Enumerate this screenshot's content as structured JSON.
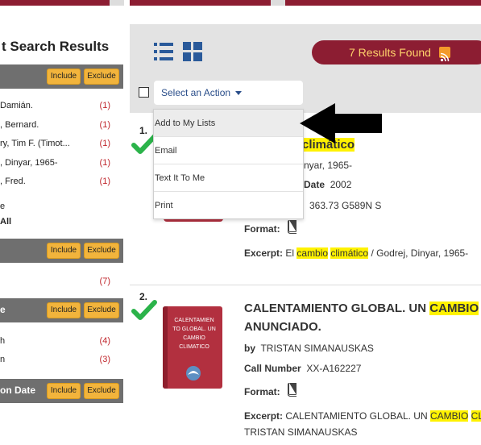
{
  "sidebar": {
    "title": "t Search Results",
    "facets": [
      {
        "label": "",
        "include": "Include",
        "exclude": "Exclude",
        "items": [
          {
            "name": "Damián.",
            "count": "(1)"
          },
          {
            "name": ", Bernard.",
            "count": "(1)"
          },
          {
            "name": "ry, Tim F. (Timot...",
            "count": "(1)"
          },
          {
            "name": ", Dinyar, 1965-",
            "count": "(1)"
          },
          {
            "name": ", Fred.",
            "count": "(1)"
          }
        ],
        "more": "e",
        "all": "All"
      },
      {
        "label": "",
        "include": "Include",
        "exclude": "Exclude",
        "items": [
          {
            "name": "",
            "count": "(7)"
          }
        ]
      },
      {
        "label": "e",
        "include": "Include",
        "exclude": "Exclude",
        "items": [
          {
            "name": "h",
            "count": "(4)"
          },
          {
            "name": "n",
            "count": "(3)"
          }
        ]
      },
      {
        "label": "on Date",
        "include": "Include",
        "exclude": "Exclude",
        "items": []
      }
    ]
  },
  "toolbar": {
    "list_view_icon": "list-icon",
    "grid_view_icon": "grid-icon",
    "results_found": "7 Results Found",
    "rss_icon": "rss-icon",
    "action_select": {
      "value": "Select an Action",
      "options": [
        "Add to My Lists",
        "Email",
        "Text It To Me",
        "Print"
      ]
    }
  },
  "results": [
    {
      "number": "1.",
      "title_visible": "climático",
      "author_visible": "nyar, 1965-",
      "date_label": "Date",
      "date_visible": "2002",
      "call_number_visible": "363.73 G589N S",
      "format_label": "Format:",
      "excerpt_label": "Excerpt:",
      "excerpt_pre": "El",
      "excerpt_hl1": "cambio",
      "excerpt_hl2": "climático",
      "excerpt_post": "/ Godrej, Dinyar, 1965-"
    },
    {
      "number": "2.",
      "cover_text": "CALENTAMIEN TO GLOBAL. UN CAMBIO CLIMATICO",
      "title_line1_pre": "CALENTAMIENTO GLOBAL. UN",
      "title_line1_hl": "CAMBIO",
      "title_line2": "ANUNCIADO.",
      "by_label": "by",
      "author": "TRISTAN SIMANAUSKAS",
      "call_number_label": "Call Number",
      "call_number": "XX-A162227",
      "format_label": "Format:",
      "excerpt_label": "Excerpt:",
      "excerpt_pre": "CALENTAMIENTO GLOBAL. UN",
      "excerpt_hl1": "CAMBIO",
      "excerpt_hl2": "CLI",
      "excerpt_line2": "TRISTAN SIMANAUSKAS"
    }
  ],
  "colors": {
    "accent": "#8c1d32",
    "highlight": "#fff200",
    "facet_bar": "#6f6f6f",
    "button": "#f2b43c",
    "count": "#c0262c"
  }
}
